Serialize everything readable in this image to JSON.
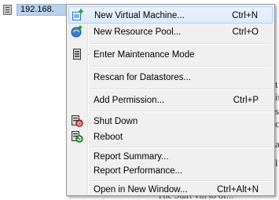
{
  "tree": {
    "host_label": "192.168."
  },
  "background": {
    "right_chars": [
      "t",
      "it",
      "sc",
      "c",
      "a",
      "l"
    ],
    "bottom_text": "The Start vin to of..."
  },
  "context_menu": {
    "items": [
      {
        "label": "New Virtual Machine...",
        "shortcut": "Ctrl+N",
        "icon": "new-vm-icon",
        "highlighted": true
      },
      {
        "label": "New Resource Pool...",
        "shortcut": "Ctrl+O",
        "icon": "resource-pool-icon"
      },
      {
        "label": "Enter Maintenance Mode",
        "shortcut": "",
        "icon": "maintenance-icon"
      },
      {
        "label": "Rescan for Datastores...",
        "shortcut": "",
        "icon": ""
      },
      {
        "label": "Add Permission...",
        "shortcut": "Ctrl+P",
        "icon": ""
      },
      {
        "label": "Shut Down",
        "shortcut": "",
        "icon": "shutdown-icon"
      },
      {
        "label": "Reboot",
        "shortcut": "",
        "icon": "reboot-icon"
      },
      {
        "label": "Report Summary...",
        "shortcut": "",
        "icon": ""
      },
      {
        "label": "Report Performance...",
        "shortcut": "",
        "icon": ""
      },
      {
        "label": "Open in New Window...",
        "shortcut": "Ctrl+Alt+N",
        "icon": ""
      }
    ]
  },
  "colors": {
    "highlight_border": "#aecff7",
    "menu_bg": "#f0f0f0",
    "selection_bg": "#b9d1ea"
  }
}
